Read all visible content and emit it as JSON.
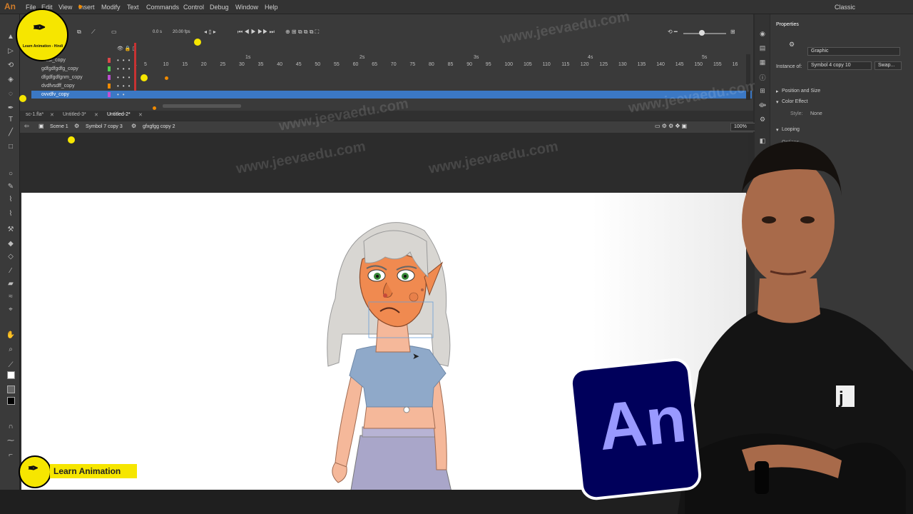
{
  "app": {
    "logo": "An",
    "menu": [
      "File",
      "Edit",
      "View",
      "Insert",
      "Modify",
      "Text",
      "Commands",
      "Control",
      "Debug",
      "Window",
      "Help"
    ],
    "workspace": "Classic"
  },
  "timeline": {
    "fps": "20.00 fps",
    "frame": "0.0 s",
    "ruler_ticks": [
      "1",
      "5",
      "10",
      "15",
      "20",
      "25",
      "30",
      "35",
      "40",
      "45",
      "50",
      "55",
      "60",
      "65",
      "70",
      "75",
      "80",
      "85",
      "90",
      "95",
      "100",
      "105",
      "110",
      "115",
      "120",
      "125",
      "130",
      "135",
      "140",
      "145",
      "150",
      "155",
      "16"
    ],
    "seconds": [
      "1s",
      "2s",
      "3s",
      "4s",
      "5s"
    ],
    "layers": [
      {
        "name": "...sdf_copy",
        "color": "#d94848"
      },
      {
        "name": "gdfgdfgdfg_copy",
        "color": "#4fd04f"
      },
      {
        "name": "dfgdfgdfgnm_copy",
        "color": "#b84fd0"
      },
      {
        "name": "dvdfvsdff_copy",
        "color": "#f08a00"
      },
      {
        "name": "ovvdfv_copy",
        "color": "#c84fd0"
      }
    ]
  },
  "doc_tabs": [
    "sc-1.fla*",
    "Untitled-3*",
    "Untitled-2*"
  ],
  "breadcrumb": [
    "Scene 1",
    "Symbol 7 copy 3",
    "gfxgfgg copy 2"
  ],
  "zoom": "100%",
  "properties": {
    "title": "Properties",
    "type": "Graphic",
    "instance_label": "Instance of:",
    "instance_value": "Symbol 4 copy 10",
    "swap": "Swap...",
    "position_size": "Position and Size",
    "color_effect": "Color Effect",
    "style_label": "Style:",
    "style_value": "None",
    "looping": "Looping",
    "options": "Options"
  },
  "branding": {
    "badge_text": "Learn Animation - Hindi",
    "banner": "Learn Animation",
    "an_logo": "An",
    "watermark": "www.jeevaedu.com"
  }
}
